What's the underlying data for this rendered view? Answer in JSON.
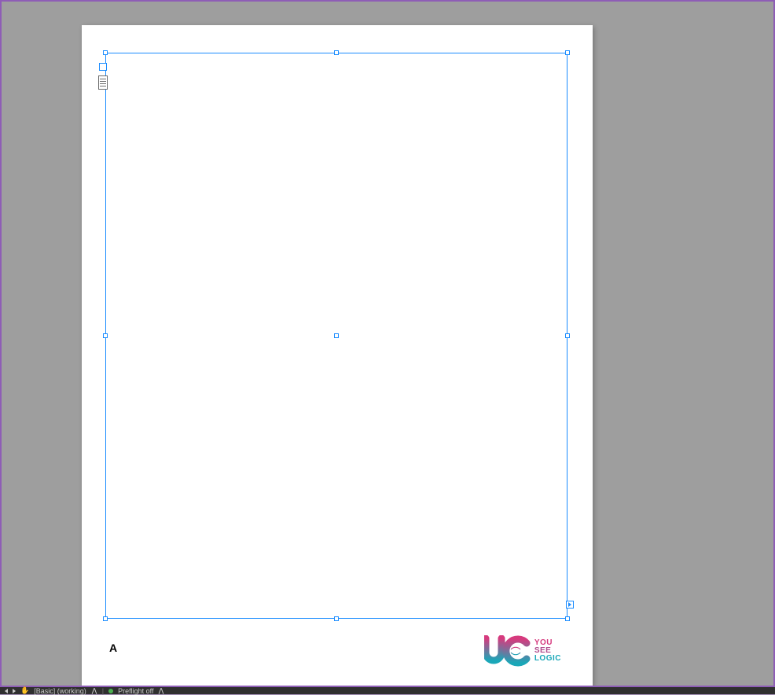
{
  "canvas": {
    "page_marker": "A",
    "frame_selected": true
  },
  "logo": {
    "line1": "YOU",
    "line2": "SEE",
    "line3": "LOGIC"
  },
  "status_bar": {
    "page_nav_prev": "◄",
    "page_nav_next": "►",
    "profile_label": "[Basic] (working)",
    "preflight_label": "Preflight off"
  }
}
